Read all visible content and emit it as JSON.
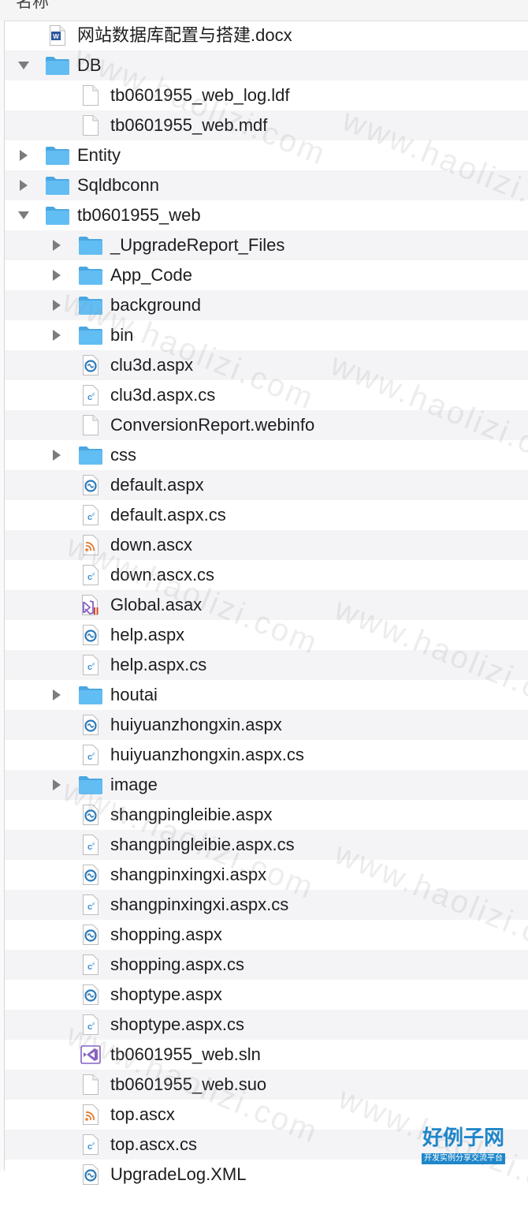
{
  "header": {
    "column_label": "名称"
  },
  "colors": {
    "folder": "#62bdf3",
    "folder_tab": "#4aa7e2",
    "row_alt": "#f4f4f6",
    "aspx_blue": "#2d7ab8",
    "cs_blue": "#3d8dd0",
    "ascx_orange": "#e5792b",
    "vs_purple": "#8661c5",
    "word_blue": "#2b579a"
  },
  "tree": [
    {
      "name": "网站数据库配置与搭建.docx",
      "level": 0,
      "kind": "docx",
      "disclosure": "none"
    },
    {
      "name": "DB",
      "level": 0,
      "kind": "folder",
      "disclosure": "open"
    },
    {
      "name": "tb0601955_web_log.ldf",
      "level": 1,
      "kind": "doc",
      "disclosure": "none"
    },
    {
      "name": "tb0601955_web.mdf",
      "level": 1,
      "kind": "doc",
      "disclosure": "none"
    },
    {
      "name": "Entity",
      "level": 0,
      "kind": "folder",
      "disclosure": "closed"
    },
    {
      "name": "Sqldbconn",
      "level": 0,
      "kind": "folder",
      "disclosure": "closed"
    },
    {
      "name": "tb0601955_web",
      "level": 0,
      "kind": "folder",
      "disclosure": "open"
    },
    {
      "name": "_UpgradeReport_Files",
      "level": 1,
      "kind": "folder",
      "disclosure": "closed"
    },
    {
      "name": "App_Code",
      "level": 1,
      "kind": "folder",
      "disclosure": "closed"
    },
    {
      "name": "background",
      "level": 1,
      "kind": "folder",
      "disclosure": "closed"
    },
    {
      "name": "bin",
      "level": 1,
      "kind": "folder",
      "disclosure": "closed"
    },
    {
      "name": "clu3d.aspx",
      "level": 1,
      "kind": "aspx",
      "disclosure": "none"
    },
    {
      "name": "clu3d.aspx.cs",
      "level": 1,
      "kind": "cs",
      "disclosure": "none"
    },
    {
      "name": "ConversionReport.webinfo",
      "level": 1,
      "kind": "doc",
      "disclosure": "none"
    },
    {
      "name": "css",
      "level": 1,
      "kind": "folder",
      "disclosure": "closed"
    },
    {
      "name": "default.aspx",
      "level": 1,
      "kind": "aspx",
      "disclosure": "none"
    },
    {
      "name": "default.aspx.cs",
      "level": 1,
      "kind": "cs",
      "disclosure": "none"
    },
    {
      "name": "down.ascx",
      "level": 1,
      "kind": "ascx",
      "disclosure": "none"
    },
    {
      "name": "down.ascx.cs",
      "level": 1,
      "kind": "cs",
      "disclosure": "none"
    },
    {
      "name": "Global.asax",
      "level": 1,
      "kind": "asax",
      "disclosure": "none"
    },
    {
      "name": "help.aspx",
      "level": 1,
      "kind": "aspx",
      "disclosure": "none"
    },
    {
      "name": "help.aspx.cs",
      "level": 1,
      "kind": "cs",
      "disclosure": "none"
    },
    {
      "name": "houtai",
      "level": 1,
      "kind": "folder",
      "disclosure": "closed"
    },
    {
      "name": "huiyuanzhongxin.aspx",
      "level": 1,
      "kind": "aspx",
      "disclosure": "none"
    },
    {
      "name": "huiyuanzhongxin.aspx.cs",
      "level": 1,
      "kind": "cs",
      "disclosure": "none"
    },
    {
      "name": "image",
      "level": 1,
      "kind": "folder",
      "disclosure": "closed"
    },
    {
      "name": "shangpingleibie.aspx",
      "level": 1,
      "kind": "aspx",
      "disclosure": "none"
    },
    {
      "name": "shangpingleibie.aspx.cs",
      "level": 1,
      "kind": "cs",
      "disclosure": "none"
    },
    {
      "name": "shangpinxingxi.aspx",
      "level": 1,
      "kind": "aspx",
      "disclosure": "none"
    },
    {
      "name": "shangpinxingxi.aspx.cs",
      "level": 1,
      "kind": "cs",
      "disclosure": "none"
    },
    {
      "name": "shopping.aspx",
      "level": 1,
      "kind": "aspx",
      "disclosure": "none"
    },
    {
      "name": "shopping.aspx.cs",
      "level": 1,
      "kind": "cs",
      "disclosure": "none"
    },
    {
      "name": "shoptype.aspx",
      "level": 1,
      "kind": "aspx",
      "disclosure": "none"
    },
    {
      "name": "shoptype.aspx.cs",
      "level": 1,
      "kind": "cs",
      "disclosure": "none"
    },
    {
      "name": "tb0601955_web.sln",
      "level": 1,
      "kind": "sln",
      "disclosure": "none"
    },
    {
      "name": "tb0601955_web.suo",
      "level": 1,
      "kind": "doc",
      "disclosure": "none"
    },
    {
      "name": "top.ascx",
      "level": 1,
      "kind": "ascx",
      "disclosure": "none"
    },
    {
      "name": "top.ascx.cs",
      "level": 1,
      "kind": "cs",
      "disclosure": "none"
    },
    {
      "name": "UpgradeLog.XML",
      "level": 1,
      "kind": "aspx",
      "disclosure": "none"
    }
  ],
  "watermark": {
    "text": "www.haolizi.com"
  },
  "logo": {
    "main": "好例子网",
    "sub": "开发实例分享交流平台"
  }
}
